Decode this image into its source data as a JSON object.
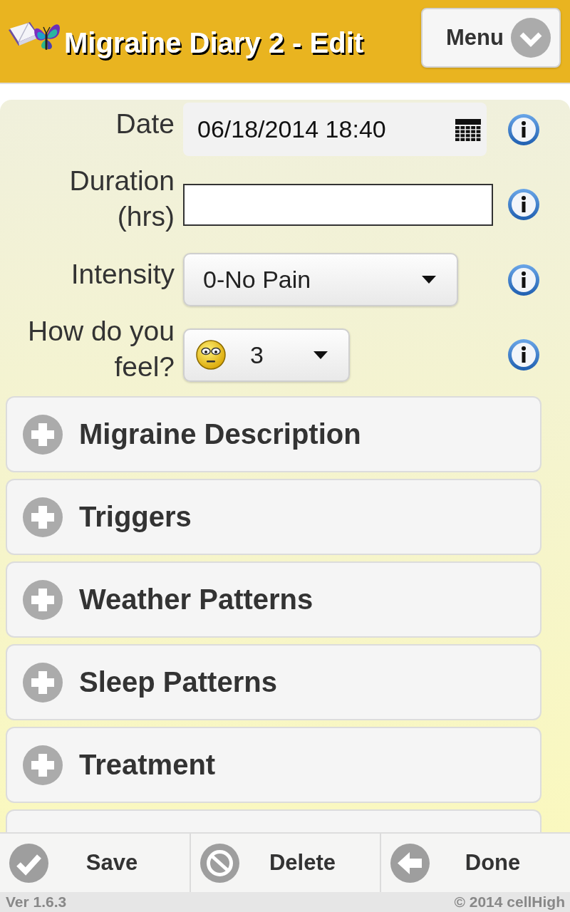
{
  "header": {
    "title": "Migraine Diary 2 - Edit",
    "menu_button": "Menu"
  },
  "form": [
    {
      "kind": "date",
      "label": "Date",
      "value": "06/18/2014 18:40"
    },
    {
      "kind": "text",
      "label": "Duration (hrs)"
    },
    {
      "kind": "select",
      "label": "Intensity",
      "value": "0-No Pain"
    },
    {
      "kind": "mood-select",
      "label": "How do you feel?",
      "value": "3"
    }
  ],
  "sections": [
    {
      "title": "Migraine Description",
      "expanded": false
    },
    {
      "title": "Triggers",
      "expanded": false
    },
    {
      "title": "Weather Patterns",
      "expanded": false
    },
    {
      "title": "Sleep Patterns",
      "expanded": false
    },
    {
      "title": "Treatment",
      "expanded": false
    }
  ],
  "actions": [
    {
      "kind": "save",
      "label": "Save"
    },
    {
      "kind": "delete",
      "label": "Delete"
    },
    {
      "kind": "done",
      "label": "Done"
    }
  ],
  "footer": {
    "version": "Ver 1.6.3",
    "copyright": "© 2014 cellHigh"
  }
}
